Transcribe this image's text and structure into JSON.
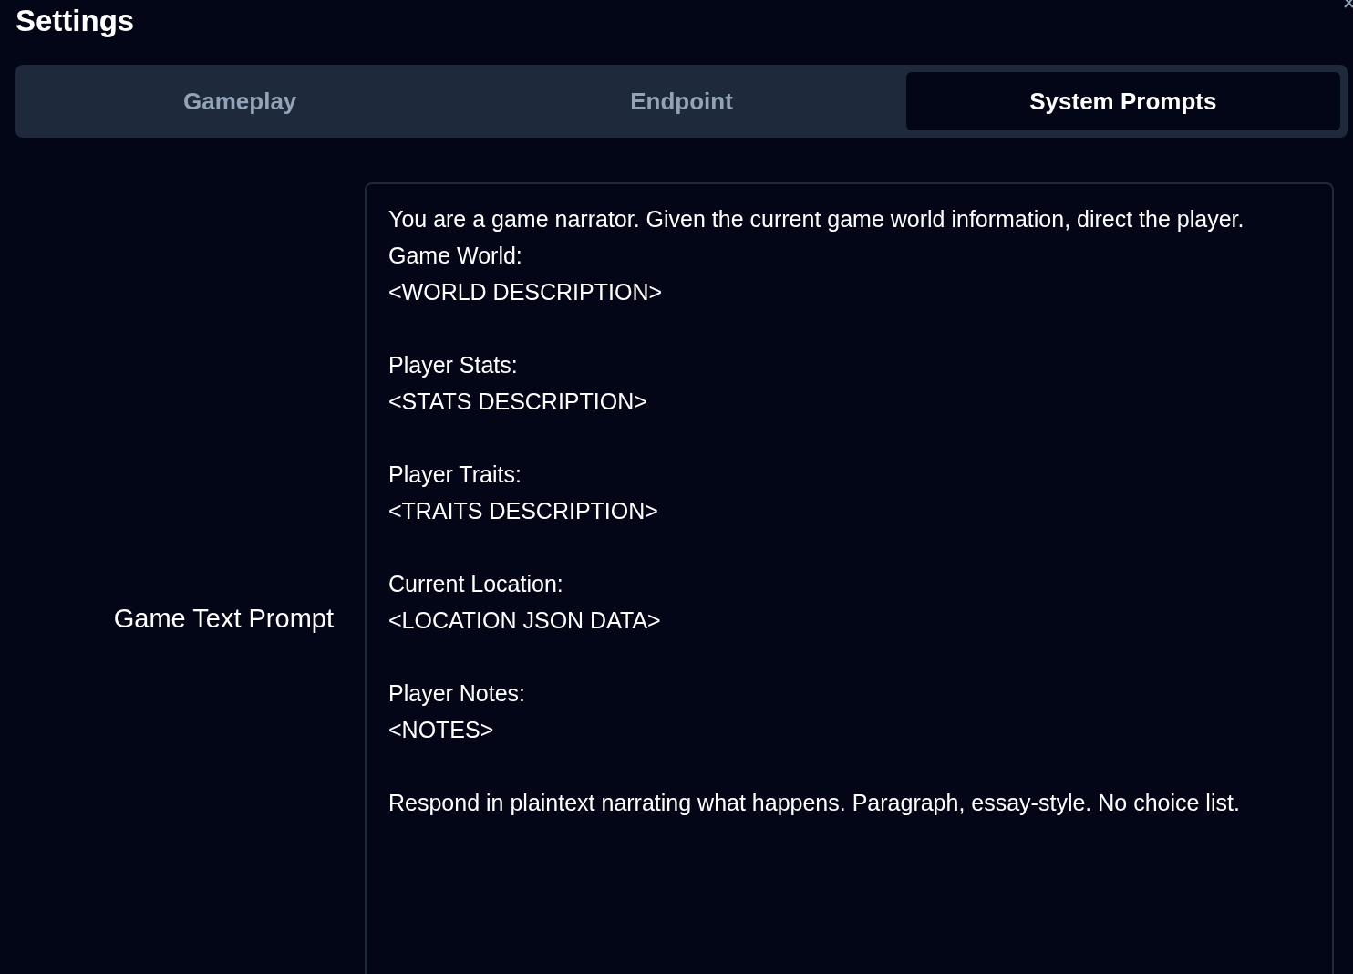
{
  "window": {
    "title": "Settings"
  },
  "tabs": [
    {
      "label": "Gameplay",
      "selected": false
    },
    {
      "label": "Endpoint",
      "selected": false
    },
    {
      "label": "System Prompts",
      "selected": true
    }
  ],
  "fields": [
    {
      "label": "Game Text Prompt",
      "value": "You are a game narrator. Given the current game world information, direct the player.\nGame World:\n<WORLD DESCRIPTION>\n\nPlayer Stats:\n<STATS DESCRIPTION>\n\nPlayer Traits:\n<TRAITS DESCRIPTION>\n\nCurrent Location:\n<LOCATION JSON DATA>\n\nPlayer Notes:\n<NOTES>\n\nRespond in plaintext narrating what happens. Paragraph, essay-style. No choice list."
    }
  ]
}
